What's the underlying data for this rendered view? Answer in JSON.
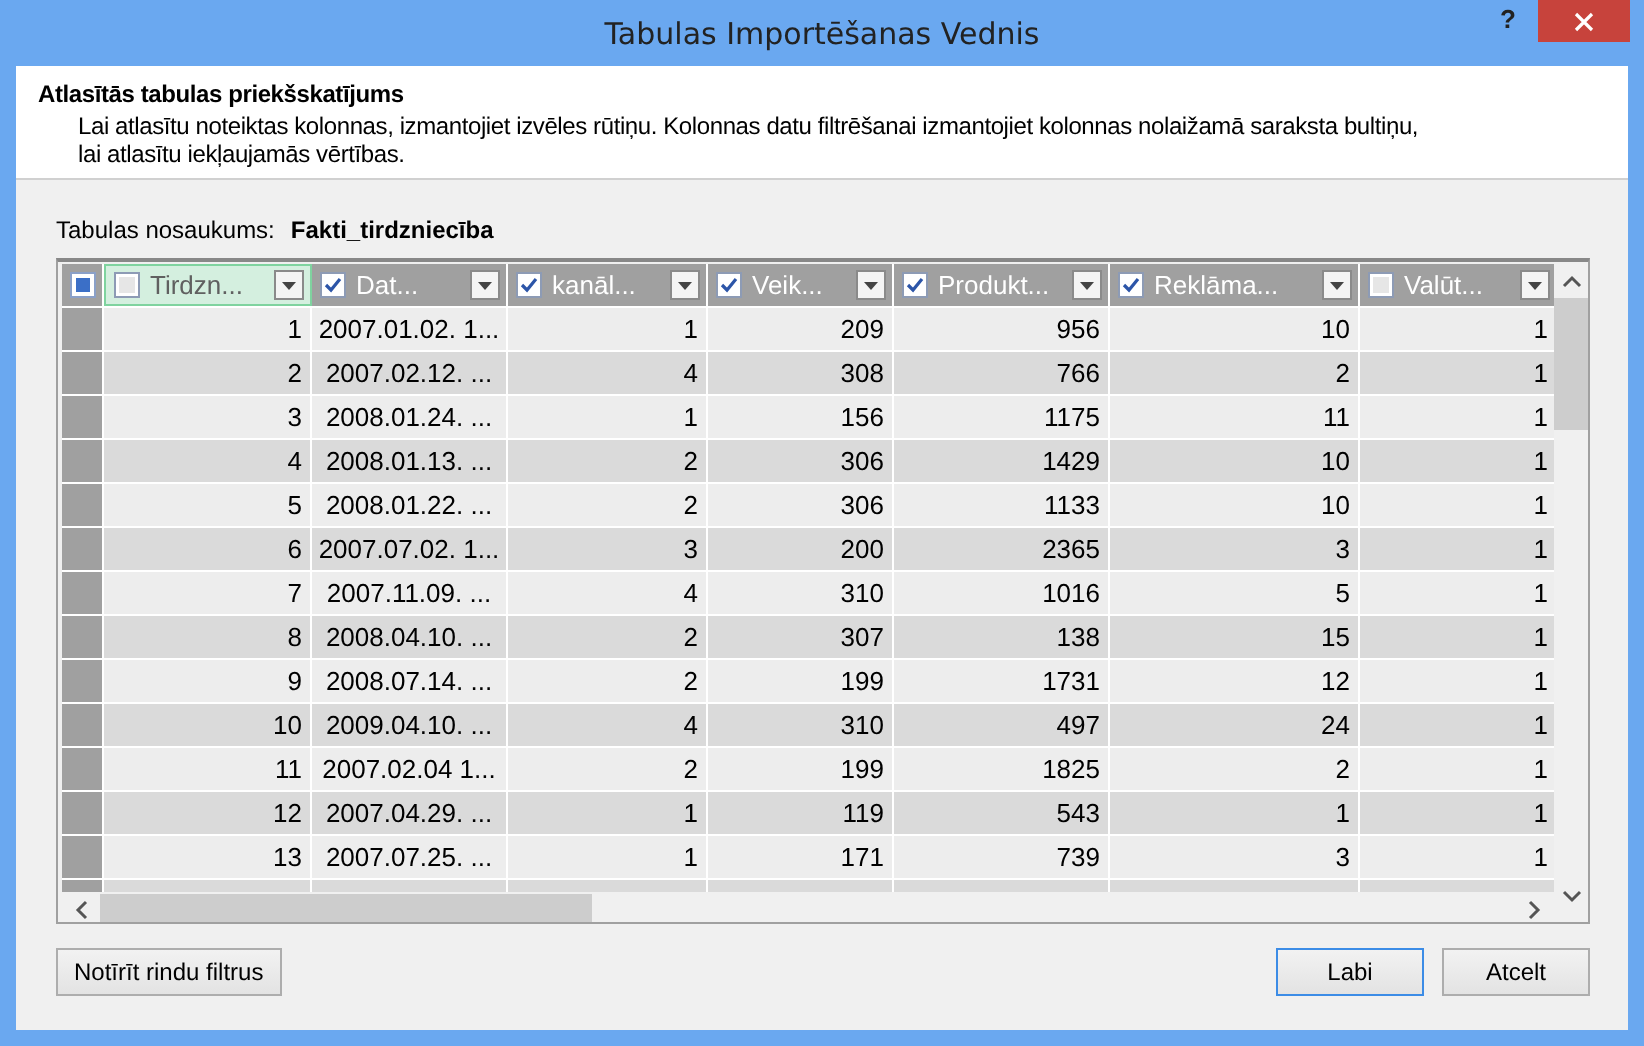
{
  "window": {
    "title": "Tabulas Importēšanas Vednis",
    "help": "?"
  },
  "header": {
    "title": "Atlasītās tabulas priekšskatījums",
    "description": "Lai atlasītu noteiktas kolonnas, izmantojiet izvēles rūtiņu. Kolonnas datu filtrēšanai izmantojiet kolonnas nolaižamā saraksta bultiņu,\nlai atlasītu iekļaujamās vērtības."
  },
  "table_name": {
    "label": "Tabulas nosaukums:",
    "value": "Fakti_tirdzniecība"
  },
  "table": {
    "select_all": {
      "indeterminate": true
    },
    "columns": [
      {
        "label": "Tirdzn...",
        "checked": false,
        "selected": true
      },
      {
        "label": "Dat...",
        "checked": true,
        "selected": false
      },
      {
        "label": "kanāl...",
        "checked": true,
        "selected": false
      },
      {
        "label": "Veik...",
        "checked": true,
        "selected": false
      },
      {
        "label": "Produkt...",
        "checked": true,
        "selected": false
      },
      {
        "label": "Reklāma...",
        "checked": true,
        "selected": false
      },
      {
        "label": "Valūt...",
        "checked": false,
        "selected": false
      }
    ],
    "rows": [
      [
        "1",
        "2007.01.02. 1...",
        "1",
        "209",
        "956",
        "10",
        "1"
      ],
      [
        "2",
        "2007.02.12. ...",
        "4",
        "308",
        "766",
        "2",
        "1"
      ],
      [
        "3",
        "2008.01.24. ...",
        "1",
        "156",
        "1175",
        "11",
        "1"
      ],
      [
        "4",
        "2008.01.13. ...",
        "2",
        "306",
        "1429",
        "10",
        "1"
      ],
      [
        "5",
        "2008.01.22. ...",
        "2",
        "306",
        "1133",
        "10",
        "1"
      ],
      [
        "6",
        "2007.07.02. 1...",
        "3",
        "200",
        "2365",
        "3",
        "1"
      ],
      [
        "7",
        "2007.11.09. ...",
        "4",
        "310",
        "1016",
        "5",
        "1"
      ],
      [
        "8",
        "2008.04.10. ...",
        "2",
        "307",
        "138",
        "15",
        "1"
      ],
      [
        "9",
        "2008.07.14. ...",
        "2",
        "199",
        "1731",
        "12",
        "1"
      ],
      [
        "10",
        "2009.04.10. ...",
        "4",
        "310",
        "497",
        "24",
        "1"
      ],
      [
        "11",
        "2007.02.04 1...",
        "2",
        "199",
        "1825",
        "2",
        "1"
      ],
      [
        "12",
        "2007.04.29. ...",
        "1",
        "119",
        "543",
        "1",
        "1"
      ],
      [
        "13",
        "2007.07.25. ...",
        "1",
        "171",
        "739",
        "3",
        "1"
      ]
    ]
  },
  "buttons": [
    {
      "label": "Notīrīt rindu filtrus",
      "kind": "left",
      "focused": false
    },
    {
      "label": "Labi",
      "kind": "right",
      "focused": true
    },
    {
      "label": "Atcelt",
      "kind": "right",
      "focused": false
    }
  ]
}
